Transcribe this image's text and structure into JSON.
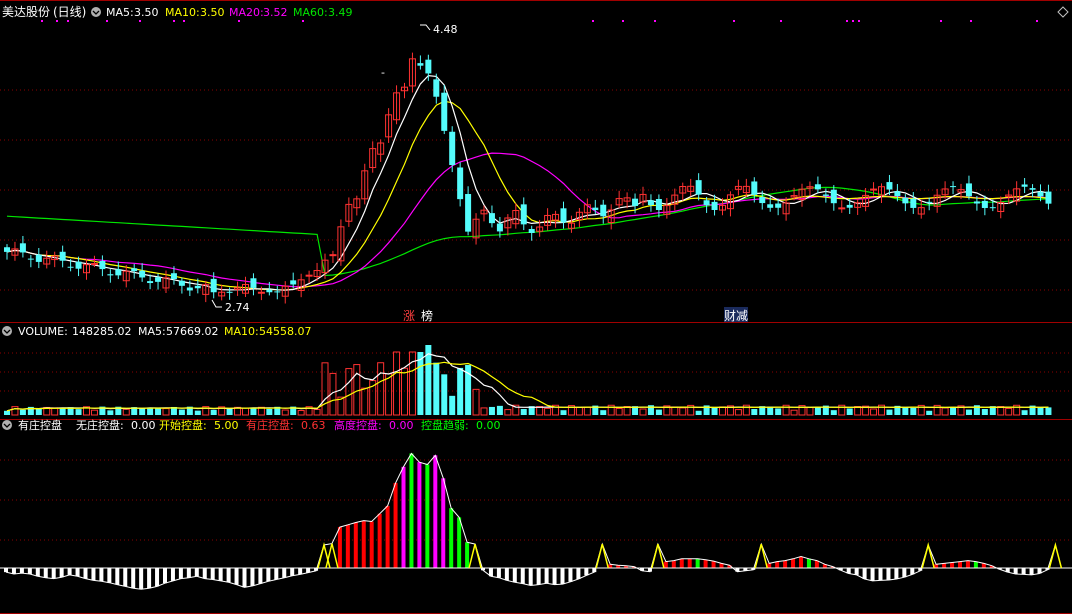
{
  "colors": {
    "up": "#ff3232",
    "down": "#54fcfc",
    "ma5": "#ffffff",
    "ma10": "#ffff00",
    "ma20": "#ff00ff",
    "ma60": "#00e600",
    "grid": "#8b0000",
    "dot": "#ff00ff",
    "wuzhuang": "#ffffff",
    "youzhuang": "#ff0000",
    "gaodu": "#ff00ff",
    "qushi": "#00ff00"
  },
  "price_panel": {
    "stock": "美达股份",
    "period": "(日线)",
    "ma5": {
      "label": "MA5:",
      "value": "3.50"
    },
    "ma10": {
      "label": "MA10:",
      "value": "3.50"
    },
    "ma20": {
      "label": "MA20:",
      "value": "3.52"
    },
    "ma60": {
      "label": "MA60:",
      "value": "3.49"
    },
    "high_label": "4.48",
    "low_label": "2.74",
    "dash_label": "-",
    "tags": [
      "涨",
      "榜",
      "财",
      "减"
    ]
  },
  "volume_panel": {
    "name": "VOLUME:",
    "value": "148285.02",
    "ma5": {
      "label": "MA5:",
      "value": "57669.02"
    },
    "ma10": {
      "label": "MA10:",
      "value": "54558.07"
    }
  },
  "indicator_panel": {
    "name": "有庄控盘",
    "items": [
      {
        "label": "无庄控盘:",
        "value": "0.00",
        "color": "#ffffff"
      },
      {
        "label": "开始控盘:",
        "value": "5.00",
        "color": "#ffff00"
      },
      {
        "label": "有庄控盘:",
        "value": "0.63",
        "color": "#ff3232"
      },
      {
        "label": "高度控盘:",
        "value": "0.00",
        "color": "#ff00ff"
      },
      {
        "label": "控盘趋弱:",
        "value": "0.00",
        "color": "#00ff00"
      }
    ]
  },
  "chart_data": {
    "type": "candlestick",
    "price_high": 4.48,
    "price_low": 2.74,
    "indicator_values": [
      -0.09,
      -0.13,
      -0.11,
      -0.13,
      -0.18,
      -0.21,
      -0.23,
      -0.2,
      -0.15,
      -0.18,
      -0.23,
      -0.27,
      -0.29,
      -0.32,
      -0.36,
      -0.4,
      -0.44,
      -0.46,
      -0.44,
      -0.4,
      -0.33,
      -0.28,
      -0.23,
      -0.21,
      -0.18,
      -0.23,
      -0.25,
      -0.28,
      -0.31,
      -0.36,
      -0.42,
      -0.39,
      -0.34,
      -0.29,
      -0.25,
      -0.21,
      -0.17,
      -0.14,
      -0.1,
      -0.06,
      0.5,
      0.53,
      0.89,
      0.94,
      0.99,
      1.03,
      1.01,
      1.18,
      1.35,
      1.85,
      2.2,
      2.49,
      2.3,
      2.25,
      2.45,
      1.95,
      1.3,
      1.1,
      0.56,
      0.52,
      -0.05,
      -0.18,
      -0.21,
      -0.27,
      -0.31,
      -0.34,
      -0.38,
      -0.36,
      -0.33,
      -0.36,
      -0.35,
      -0.3,
      -0.24,
      -0.16,
      -0.09,
      0.52,
      0.08,
      0.06,
      0.05,
      0.03,
      -0.06,
      -0.08,
      0.52,
      0.14,
      0.16,
      0.2,
      0.2,
      0.2,
      0.18,
      0.15,
      0.1,
      0.06,
      -0.08,
      -0.06,
      -0.04,
      0.52,
      0.1,
      0.14,
      0.16,
      0.2,
      0.25,
      0.2,
      0.16,
      0.08,
      0.03,
      -0.05,
      -0.12,
      -0.15,
      -0.24,
      -0.28,
      -0.27,
      -0.26,
      -0.24,
      -0.2,
      -0.14,
      -0.06,
      0.5,
      0.08,
      0.1,
      0.12,
      0.14,
      0.16,
      0.14,
      0.1,
      0.05,
      -0.03,
      -0.09,
      -0.13,
      -0.14,
      -0.15,
      -0.12,
      -0.04,
      0.5
    ]
  }
}
